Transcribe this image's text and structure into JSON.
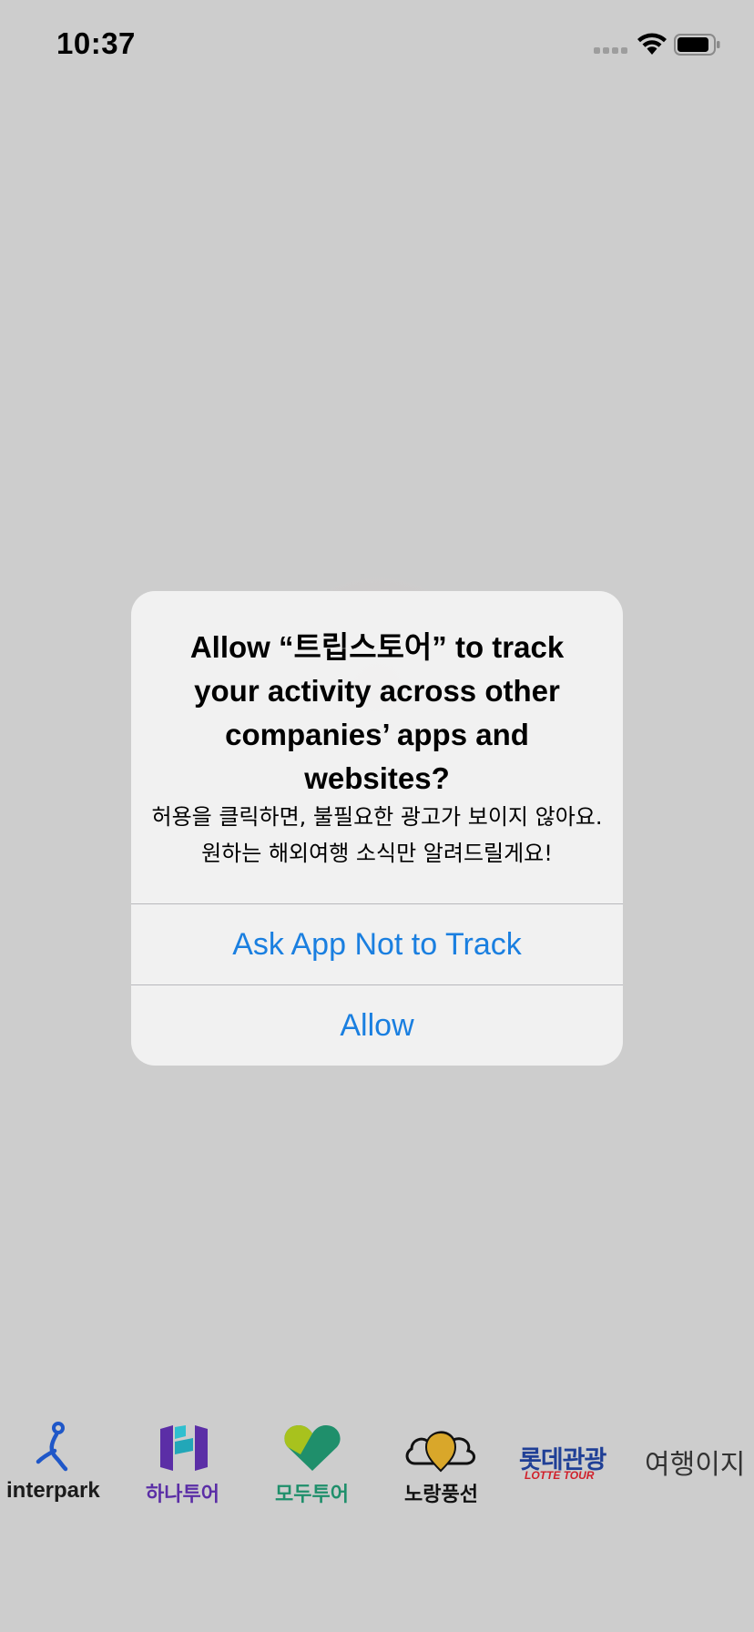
{
  "status_bar": {
    "time": "10:37",
    "icons": [
      "cellular-signal-icon",
      "wifi-icon",
      "battery-icon"
    ]
  },
  "alert": {
    "title": "Allow “트립스토어” to track your activity across other companies’ apps and websites?",
    "message": "허용을 클릭하면, 불필요한 광고가 보이지 않아요. 원하는 해외여행 소식만 알려드릴게요!",
    "buttons": {
      "deny": "Ask App Not to Track",
      "allow": "Allow"
    }
  },
  "partners": [
    {
      "name": "interpark",
      "icon": "interpark-runner-icon",
      "color": "#1b1b1b",
      "accent": "#1f57c8"
    },
    {
      "name": "하나투어",
      "icon": "hanatour-h-icon",
      "color": "#5b2ea6",
      "accent": "#22a7b8"
    },
    {
      "name": "모두투어",
      "icon": "modetour-heart-icon",
      "color": "#1f8f6b",
      "accent": "#a8c21d"
    },
    {
      "name": "노랑풍선",
      "icon": "yellow-balloon-icon",
      "color": "#111111",
      "accent": "#d9a72a"
    },
    {
      "name": "롯데관광",
      "sub": "LOTTE TOUR",
      "icon": "lottetour-logo",
      "color": "#1f3f96",
      "accent": "#d0202a"
    },
    {
      "name": "여행이지",
      "icon": "travel-easy-logo",
      "color": "#333333",
      "accent": "#e03a3a"
    }
  ],
  "colors": {
    "background": "#cdcdcd",
    "alert_background": "#f2f2f2",
    "button_blue": "#1a7fe0"
  }
}
